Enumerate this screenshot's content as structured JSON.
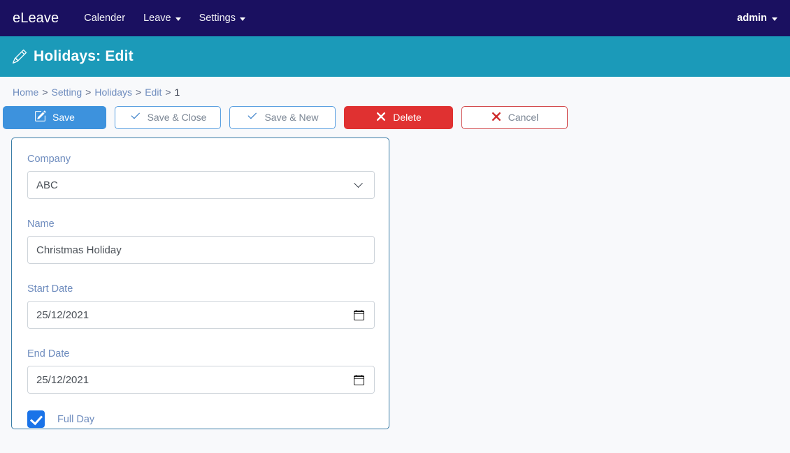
{
  "navbar": {
    "brand": "eLeave",
    "items": [
      {
        "label": "Calender",
        "has_caret": false
      },
      {
        "label": "Leave",
        "has_caret": true
      },
      {
        "label": "Settings",
        "has_caret": true
      }
    ],
    "user": "admin",
    "background_color": "#1a1060"
  },
  "page_header": {
    "icon": "pencil-icon",
    "title": "Holidays: Edit",
    "background_color": "#1b9ab9"
  },
  "breadcrumb": {
    "separator": ">",
    "items": [
      {
        "label": "Home",
        "link": true
      },
      {
        "label": "Setting",
        "link": true
      },
      {
        "label": "Holidays",
        "link": true
      },
      {
        "label": "Edit",
        "link": true
      },
      {
        "label": "1",
        "link": false
      }
    ]
  },
  "toolbar": {
    "save_label": "Save",
    "save_close_label": "Save & Close",
    "save_new_label": "Save & New",
    "delete_label": "Delete",
    "cancel_label": "Cancel",
    "primary_color": "#3d92dd",
    "danger_color": "#e03131"
  },
  "form": {
    "company": {
      "label": "Company",
      "value": "ABC",
      "options": [
        "ABC"
      ]
    },
    "name": {
      "label": "Name",
      "value": "Christmas Holiday",
      "placeholder": ""
    },
    "start_date": {
      "label": "Start Date",
      "value": "25/12/2021"
    },
    "end_date": {
      "label": "End Date",
      "value": "25/12/2021"
    },
    "full_day": {
      "label": "Full Day",
      "checked": true
    }
  }
}
